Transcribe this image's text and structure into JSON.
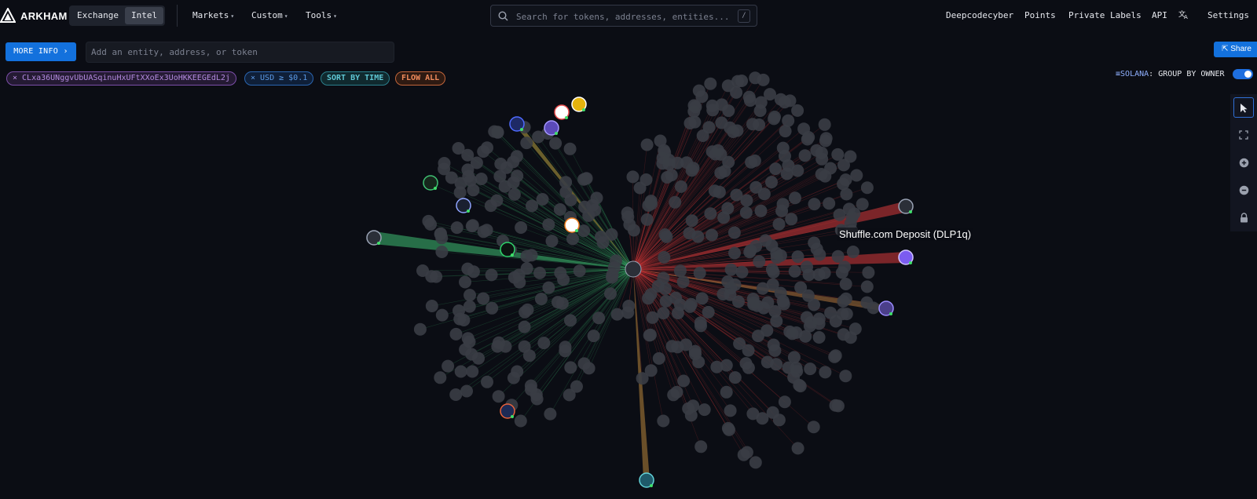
{
  "app": {
    "brand": "ARKHAM",
    "modes": [
      "Exchange",
      "Intel"
    ],
    "active_mode": "Intel"
  },
  "nav": {
    "markets": "Markets",
    "custom": "Custom",
    "tools": "Tools"
  },
  "search": {
    "placeholder": "Search for tokens, addresses, entities...",
    "shortcut": "/"
  },
  "right_nav": {
    "user": "Deepcodecyber",
    "points": "Points",
    "private_labels": "Private Labels",
    "api": "API",
    "settings": "Settings"
  },
  "controls": {
    "more_info": "MORE INFO ›",
    "add_placeholder": "Add an entity, address, or token",
    "share": "Share"
  },
  "filters": {
    "address_chip": "× CLxa36UNggvUbUASqinuHxUFtXXoEx3UoHKKEEGEdL2j",
    "usd_chip": "× USD ≥ $0.1",
    "sort_chip": "SORT BY TIME",
    "flow_chip": "FLOW ALL"
  },
  "graph_options": {
    "network": "SOLANA",
    "group_label": ": GROUP BY OWNER",
    "group_by_owner": true
  },
  "graph": {
    "tooltip": "Shuffle.com Deposit (DLP1q)",
    "colors": {
      "background": "#0b0d14",
      "inflow": "#3fbf72",
      "outflow": "#d83a3a",
      "node": "#3a3d45",
      "accent": "#1371dd"
    }
  },
  "toolbar": {
    "icons": [
      "pointer-icon",
      "fit-screen-icon",
      "zoom-in-icon",
      "zoom-out-icon",
      "lock-icon"
    ]
  }
}
